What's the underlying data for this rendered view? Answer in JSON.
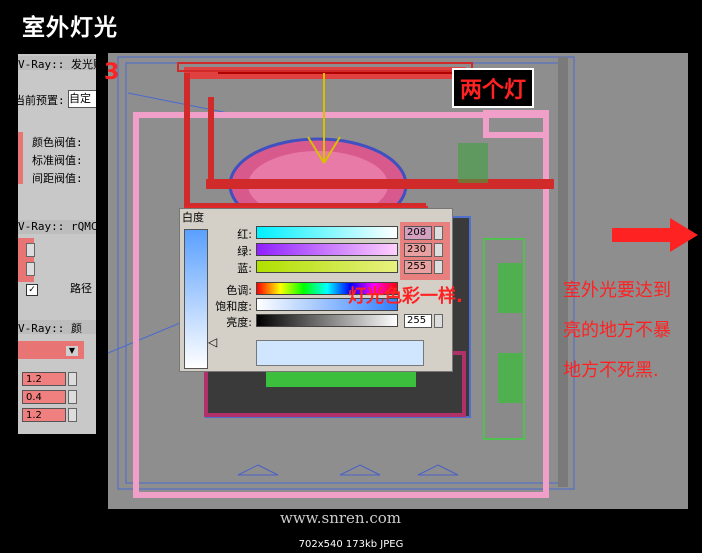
{
  "title": "室外灯光",
  "step_number": "3",
  "annotations": {
    "two_lights": "两个灯",
    "same_color": "灯光色彩一样.",
    "note_lines": [
      "室外光要达到",
      "亮的地方不暴",
      "地方不死黑."
    ]
  },
  "vray_panel": {
    "header1": "V-Ray:: 发光贴",
    "preset_label": "当前预置:",
    "preset_value": "自定",
    "threshold_labels": [
      "颜色阀值:",
      "标准阀值:",
      "间距阀值:"
    ],
    "header2": "V-Ray:: rQMC",
    "path_label": "路径",
    "header3": "V-Ray:: 颜",
    "values": [
      "1.2",
      "0.4",
      "1.2"
    ]
  },
  "color_dialog": {
    "title": "白度",
    "red_label": "红:",
    "green_label": "绿:",
    "blue_label": "蓝:",
    "hue_label": "色调:",
    "sat_label": "饱和度:",
    "val_label": "亮度:",
    "red": "208",
    "green": "230",
    "blue": "255",
    "value": "255"
  },
  "watermark": "www.snren.com",
  "caption": "702x540  173kb  JPEG",
  "colors": {
    "annotation_red": "#ff2222",
    "swatch": "#d0e6ff",
    "panel_bg": "#c8c8c8"
  }
}
